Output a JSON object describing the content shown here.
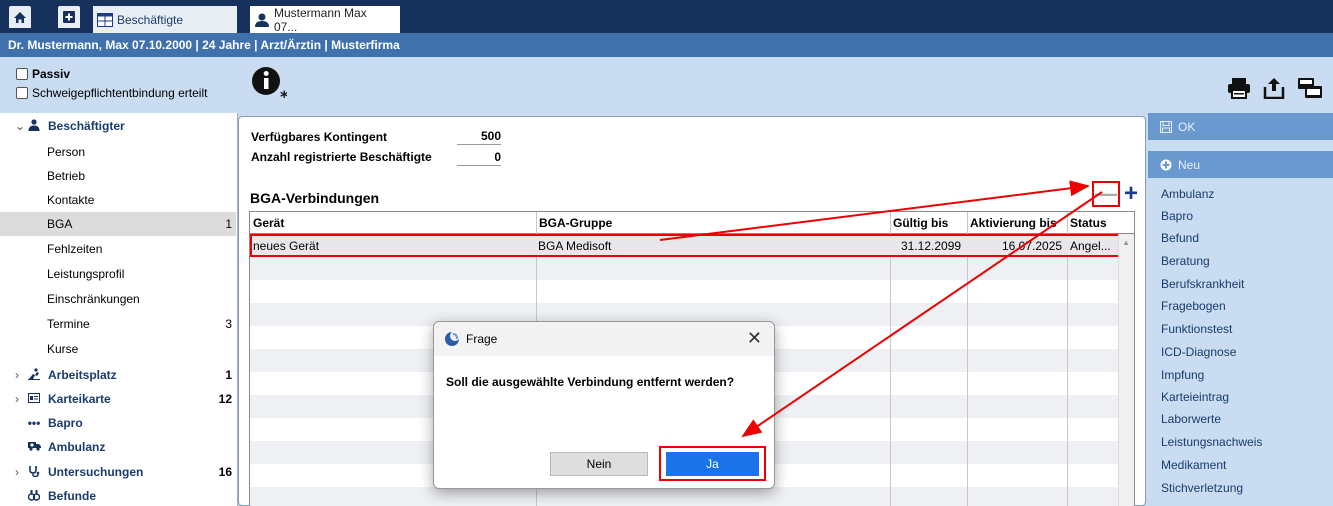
{
  "tabs": {
    "home_icon": "home-icon",
    "plus_icon": "plus-square-icon",
    "beschaeftigte_label": "Beschäftigte",
    "patient_label": "Mustermann Max  07..."
  },
  "header": {
    "info": "Dr. Mustermann, Max 07.10.2000 | 24 Jahre | Arzt/Ärztin | Musterfirma"
  },
  "options": {
    "passiv_label": "Passiv",
    "schweige_label": "Schweigepflichtentbindung erteilt",
    "passiv_checked": false,
    "schweige_checked": false
  },
  "sidebar": {
    "beschaeftigter": {
      "label": "Beschäftigter",
      "icon": "person-icon"
    },
    "sub_items": [
      {
        "label": "Person",
        "count": ""
      },
      {
        "label": "Betrieb",
        "count": ""
      },
      {
        "label": "Kontakte",
        "count": ""
      },
      {
        "label": "BGA",
        "count": "1"
      },
      {
        "label": "Fehlzeiten",
        "count": ""
      },
      {
        "label": "Leistungsprofil",
        "count": ""
      },
      {
        "label": "Einschränkungen",
        "count": ""
      },
      {
        "label": "Termine",
        "count": "3"
      },
      {
        "label": "Kurse",
        "count": ""
      }
    ],
    "groups": [
      {
        "label": "Arbeitsplatz",
        "count": "1",
        "icon": "workplace-icon"
      },
      {
        "label": "Karteikarte",
        "count": "12",
        "icon": "card-icon"
      },
      {
        "label": "Bapro",
        "count": "",
        "icon": "dots-icon"
      },
      {
        "label": "Ambulanz",
        "count": "",
        "icon": "ambulance-icon"
      },
      {
        "label": "Untersuchungen",
        "count": "16",
        "icon": "stethoscope-icon"
      },
      {
        "label": "Befunde",
        "count": "",
        "icon": "findings-icon"
      }
    ]
  },
  "main": {
    "kontingent_label": "Verfügbares Kontingent",
    "kontingent_value": "500",
    "registriert_label": "Anzahl registrierte Beschäftigte",
    "registriert_value": "0",
    "section_title": "BGA-Verbindungen",
    "columns": [
      "Gerät",
      "BGA-Gruppe",
      "Gültig bis",
      "Aktivierung bis",
      "Status"
    ],
    "rows": [
      {
        "geraet": "neues Gerät",
        "gruppe": "BGA Medisoft",
        "gueltig": "31.12.2099",
        "aktivierung": "16.07.2025",
        "status": "Angel..."
      }
    ]
  },
  "actions": {
    "ok_label": "OK",
    "neu_label": "Neu",
    "items": [
      "Ambulanz",
      "Bapro",
      "Befund",
      "Beratung",
      "Berufskrankheit",
      "Fragebogen",
      "Funktionstest",
      "ICD-Diagnose",
      "Impfung",
      "Karteieintrag",
      "Laborwerte",
      "Leistungsnachweis",
      "Medikament",
      "Stichverletzung"
    ]
  },
  "dialog": {
    "title": "Frage",
    "message": "Soll die ausgewählte Verbindung entfernt werden?",
    "no_label": "Nein",
    "yes_label": "Ja"
  },
  "colors": {
    "header_dark": "#16325c",
    "header_blue": "#3f72ad",
    "panel_light": "#c9dcf2",
    "action_btn": "#6a99cf",
    "highlight_red": "#ee0000",
    "primary_blue": "#1a73e8"
  }
}
